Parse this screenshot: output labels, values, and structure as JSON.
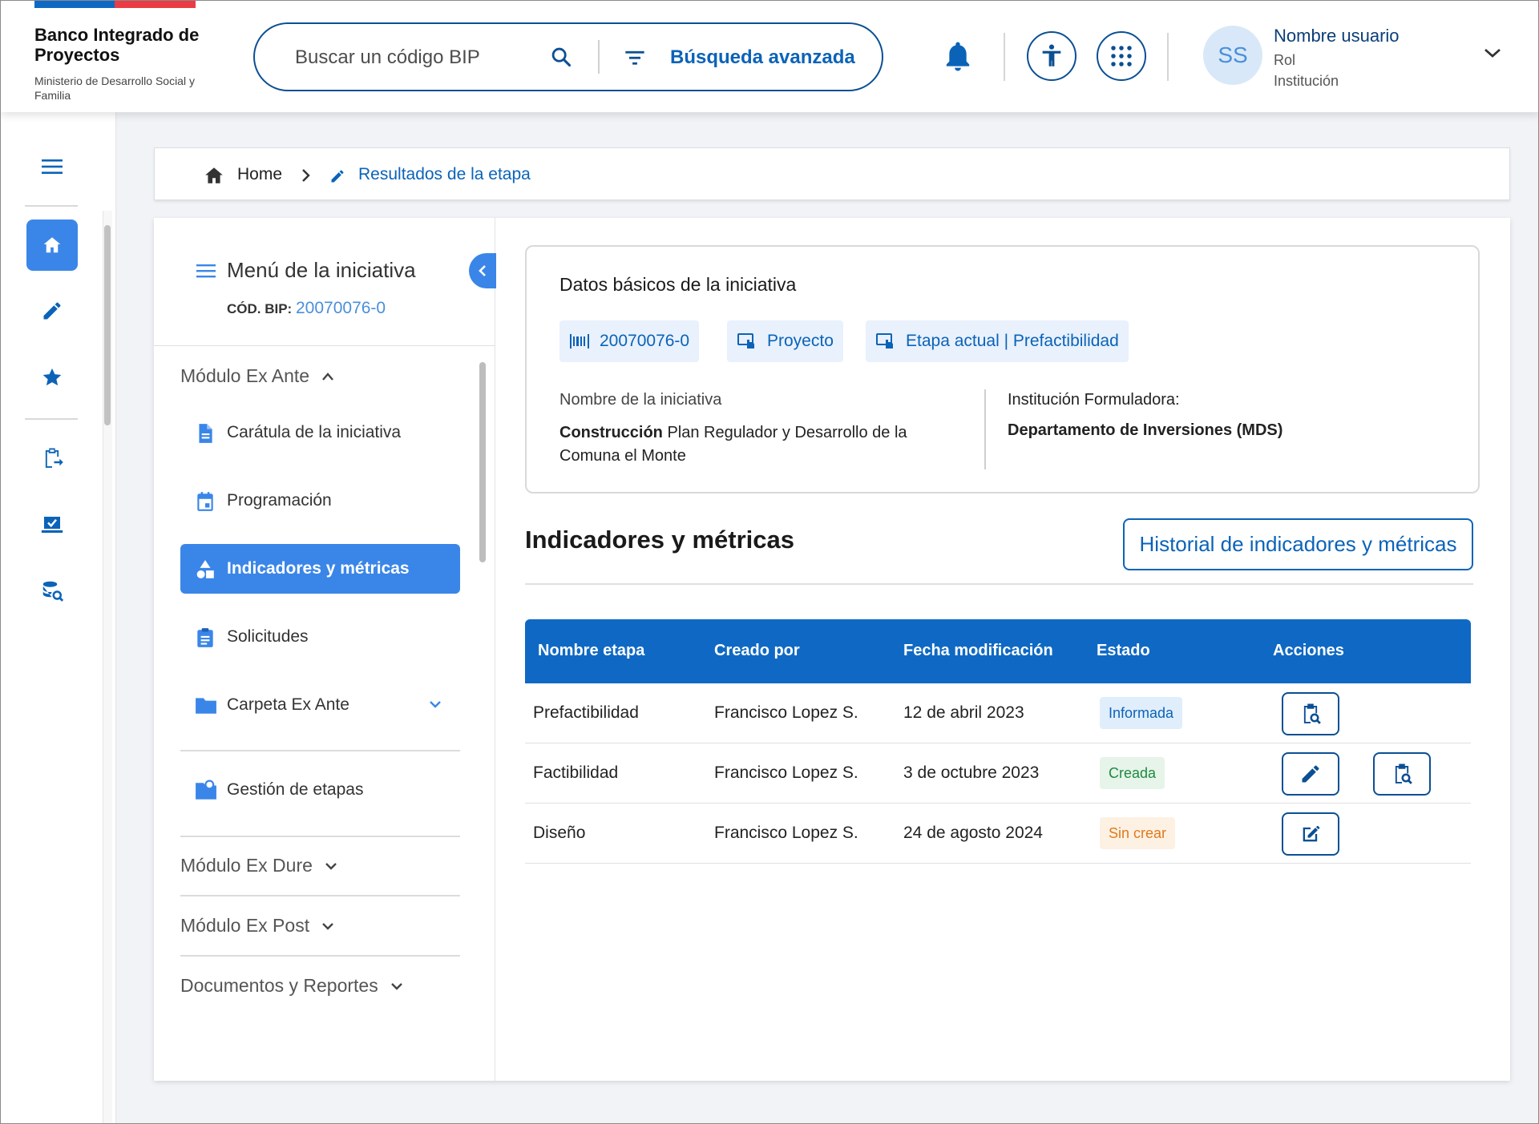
{
  "header": {
    "logo_title": "Banco Integrado de Proyectos",
    "logo_subtitle": "Ministerio de Desarrollo Social y Familia",
    "search_placeholder": "Buscar un código BIP",
    "advanced_search": "Búsqueda avanzada",
    "user": {
      "initials": "SS",
      "name": "Nombre usuario",
      "role": "Rol",
      "institution": "Institución"
    }
  },
  "breadcrumb": {
    "home": "Home",
    "current": "Resultados de la etapa"
  },
  "menu": {
    "title": "Menú de la iniciativa",
    "code_label": "CÓD. BIP:",
    "code_value": "20070076-0",
    "modules": {
      "ex_ante": "Módulo Ex Ante",
      "ex_dure": "Módulo Ex Dure",
      "ex_post": "Módulo Ex Post",
      "docs": "Documentos y Reportes"
    },
    "items": [
      {
        "label": "Carátula de la iniciativa",
        "icon": "document-icon"
      },
      {
        "label": "Programación",
        "icon": "calendar-icon"
      },
      {
        "label": "Indicadores y métricas",
        "icon": "shapes-icon"
      },
      {
        "label": "Solicitudes",
        "icon": "clipboard-icon"
      },
      {
        "label": "Carpeta Ex Ante",
        "icon": "folder-icon"
      },
      {
        "label": "Gestión de etapas",
        "icon": "folder-search-icon"
      }
    ]
  },
  "datos": {
    "title": "Datos básicos de la iniciativa",
    "chips": {
      "code": "20070076-0",
      "type": "Proyecto",
      "stage": "Etapa actual | Prefactibilidad"
    },
    "name_label": "Nombre de la iniciativa",
    "name_bold": "Construcción",
    "name_rest": " Plan Regulador y Desarrollo de la Comuna el Monte",
    "inst_label": "Institución Formuladora:",
    "inst_value": "Departamento de Inversiones (MDS)"
  },
  "section": {
    "title": "Indicadores y métricas",
    "history_button": "Historial de indicadores y métricas"
  },
  "table": {
    "headers": [
      "Nombre etapa",
      "Creado por",
      "Fecha modificación",
      "Estado",
      "Acciones"
    ],
    "rows": [
      {
        "stage": "Prefactibilidad",
        "by": "Francisco Lopez S.",
        "date": "12 de abril 2023",
        "status": "Informada"
      },
      {
        "stage": "Factibilidad",
        "by": "Francisco Lopez S.",
        "date": "3 de octubre 2023",
        "status": "Creada"
      },
      {
        "stage": "Diseño",
        "by": "Francisco Lopez S.",
        "date": "24 de agosto 2024",
        "status": "Sin crear"
      }
    ]
  },
  "colors": {
    "primary": "#0f69c4",
    "accent": "#3a86e8",
    "informada_bg": "#e0eefc",
    "creada_bg": "#e6f4ea",
    "sin_crear_bg": "#fdf1e4"
  }
}
